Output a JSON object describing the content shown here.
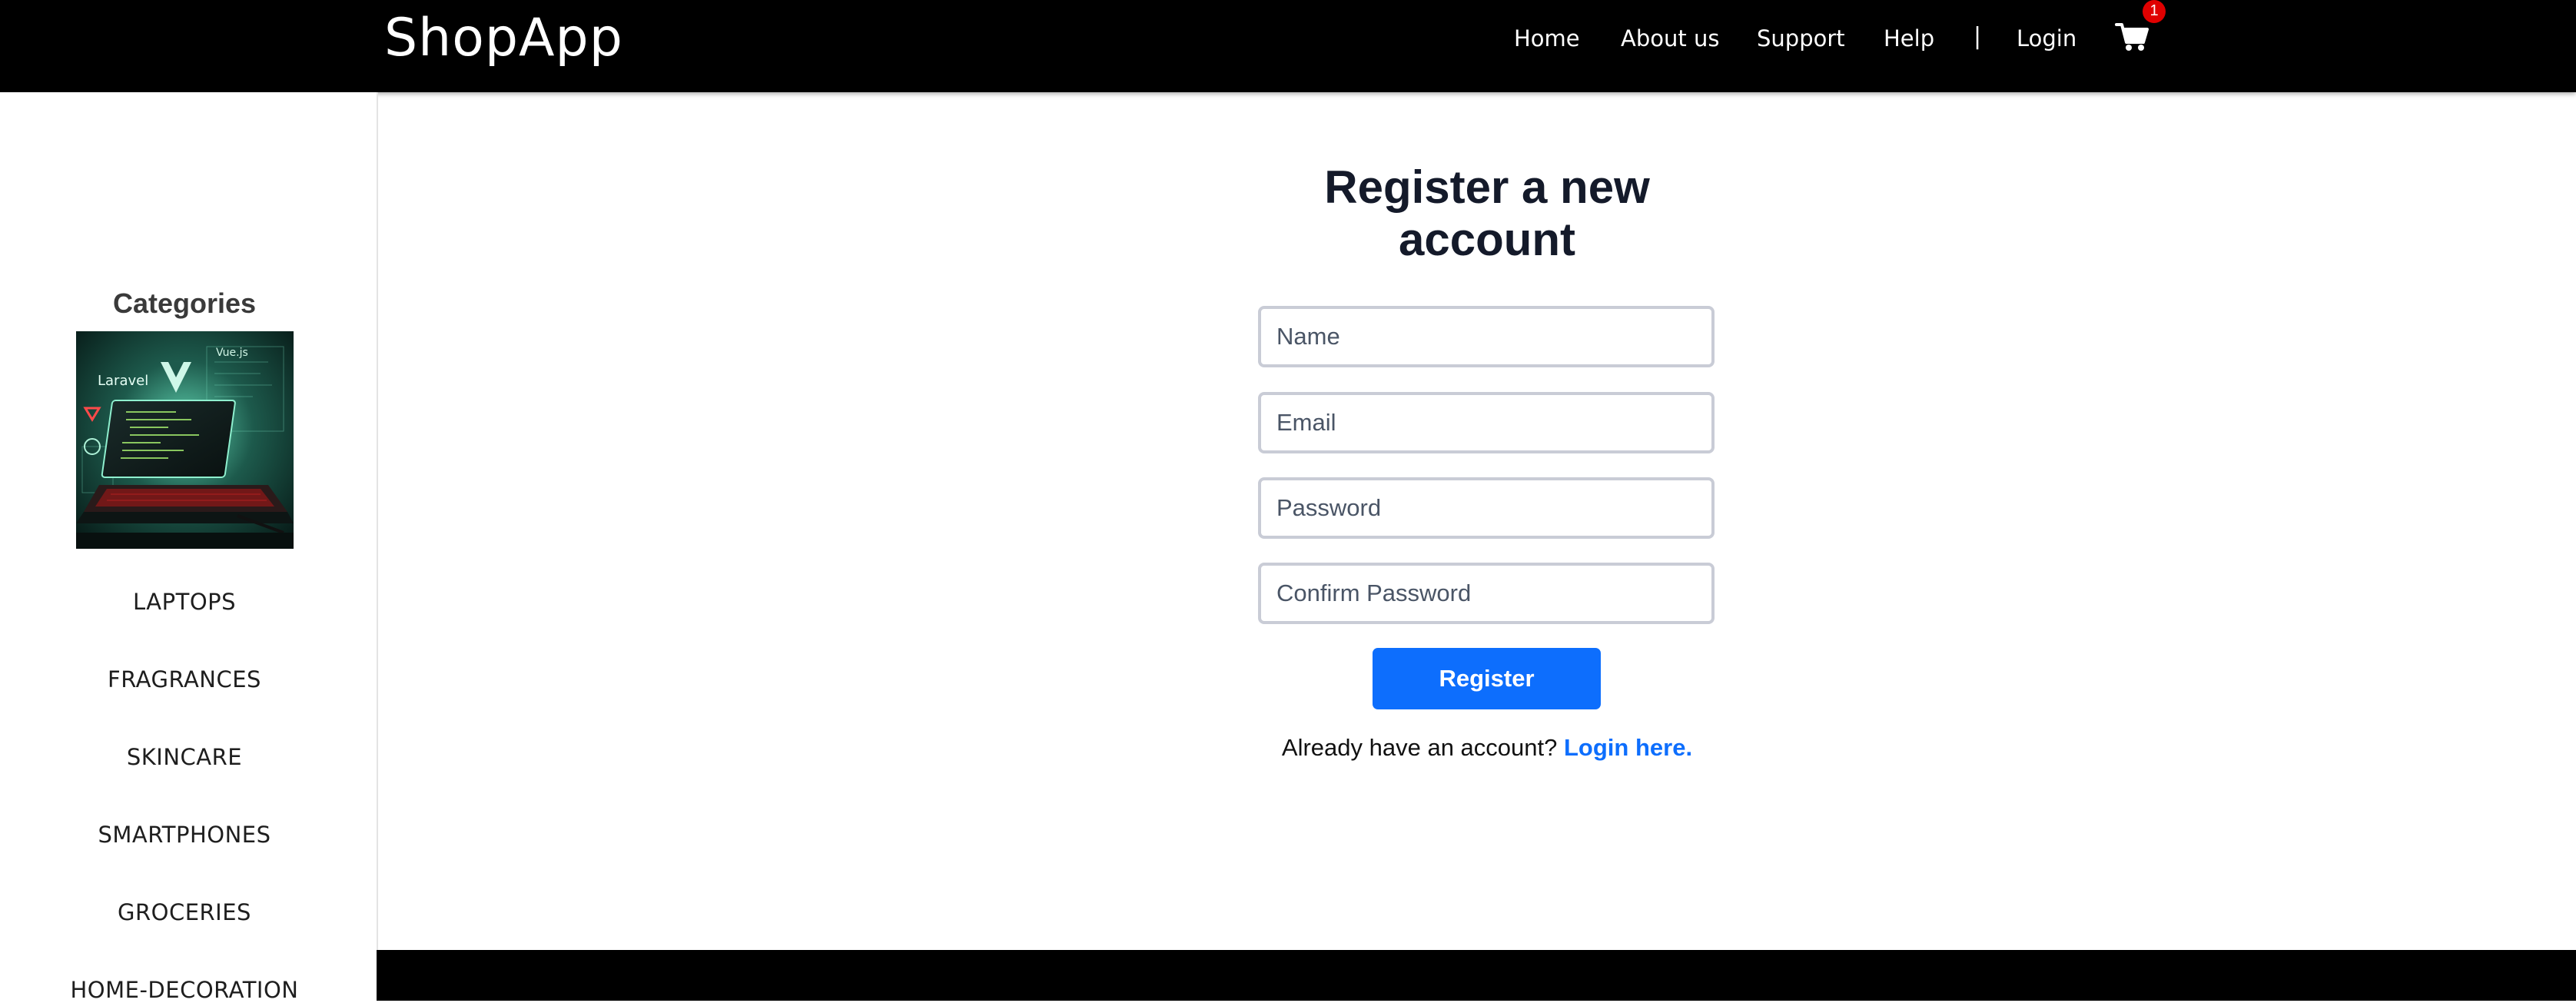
{
  "header": {
    "brand": "ShopApp",
    "nav": [
      {
        "label": "Home"
      },
      {
        "label": "About us"
      },
      {
        "label": "Support"
      },
      {
        "label": "Help"
      }
    ],
    "separator": "|",
    "login": "Login",
    "cart_icon": "shopping-cart-icon",
    "cart_count": "1"
  },
  "sidebar": {
    "title": "Categories",
    "image_icon": "category-banner-image",
    "items": [
      {
        "label": "LAPTOPS"
      },
      {
        "label": "FRAGRANCES"
      },
      {
        "label": "SKINCARE"
      },
      {
        "label": "SMARTPHONES"
      },
      {
        "label": "GROCERIES"
      },
      {
        "label": "HOME-DECORATION"
      }
    ]
  },
  "form": {
    "title_line1": "Register a new",
    "title_line2": "account",
    "fields": [
      {
        "placeholder": "Name",
        "value": ""
      },
      {
        "placeholder": "Email",
        "value": ""
      },
      {
        "placeholder": "Password",
        "value": ""
      },
      {
        "placeholder": "Confirm Password",
        "value": ""
      }
    ],
    "submit_label": "Register",
    "already_text": "Already have an account?",
    "login_link": "Login here."
  },
  "colors": {
    "header_bg": "#000000",
    "accent": "#0d6efd",
    "badge": "#e00000",
    "title": "#141a2a"
  }
}
